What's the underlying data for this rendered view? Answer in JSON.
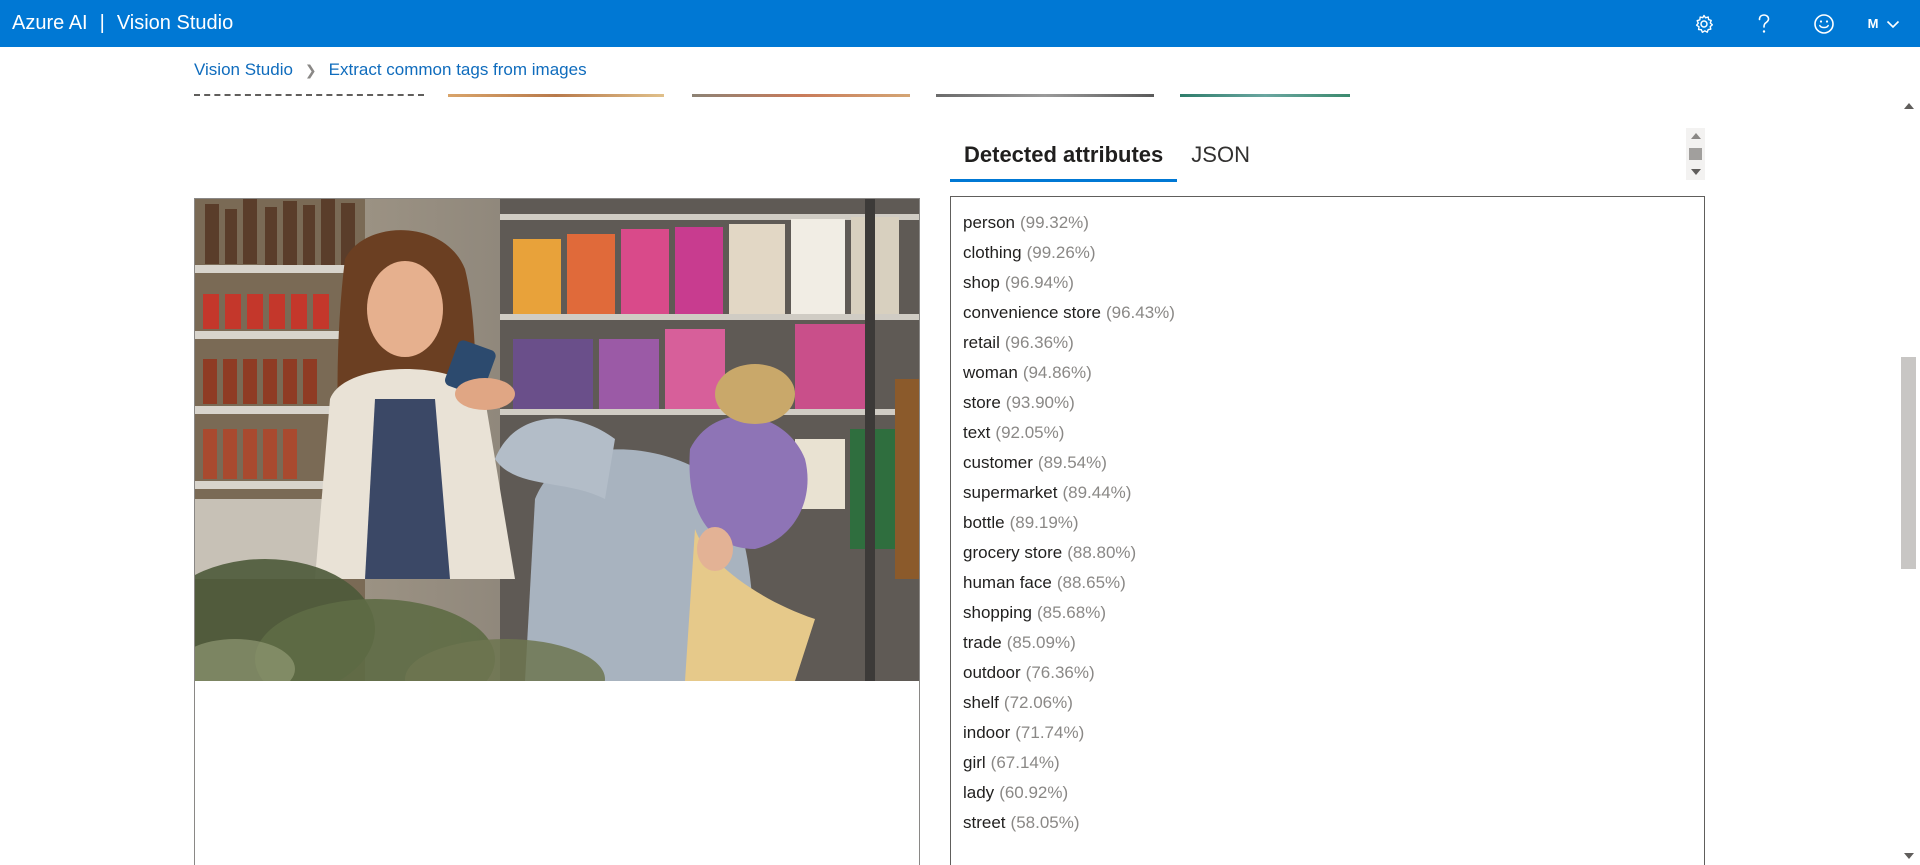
{
  "app": {
    "brand": "Azure AI",
    "separator": "|",
    "product": "Vision Studio",
    "accent_color": "#0078d4"
  },
  "header_icons": [
    "settings-icon",
    "help-icon",
    "feedback-smiley-icon",
    "chevron-down-icon"
  ],
  "account": {
    "initial": "M"
  },
  "breadcrumb": {
    "home": "Vision Studio",
    "current": "Extract common tags from images"
  },
  "tabs": [
    {
      "label": "Detected attributes",
      "active": true
    },
    {
      "label": "JSON",
      "active": false
    }
  ],
  "attributes": [
    {
      "name": "person",
      "confidence": "(99.32%)"
    },
    {
      "name": "clothing",
      "confidence": "(99.26%)"
    },
    {
      "name": "shop",
      "confidence": "(96.94%)"
    },
    {
      "name": "convenience store",
      "confidence": "(96.43%)"
    },
    {
      "name": "retail",
      "confidence": "(96.36%)"
    },
    {
      "name": "woman",
      "confidence": "(94.86%)"
    },
    {
      "name": "store",
      "confidence": "(93.90%)"
    },
    {
      "name": "text",
      "confidence": "(92.05%)"
    },
    {
      "name": "customer",
      "confidence": "(89.54%)"
    },
    {
      "name": "supermarket",
      "confidence": "(89.44%)"
    },
    {
      "name": "bottle",
      "confidence": "(89.19%)"
    },
    {
      "name": "grocery store",
      "confidence": "(88.80%)"
    },
    {
      "name": "human face",
      "confidence": "(88.65%)"
    },
    {
      "name": "shopping",
      "confidence": "(85.68%)"
    },
    {
      "name": "trade",
      "confidence": "(85.09%)"
    },
    {
      "name": "outdoor",
      "confidence": "(76.36%)"
    },
    {
      "name": "shelf",
      "confidence": "(72.06%)"
    },
    {
      "name": "indoor",
      "confidence": "(71.74%)"
    },
    {
      "name": "girl",
      "confidence": "(67.14%)"
    },
    {
      "name": "lady",
      "confidence": "(60.92%)"
    },
    {
      "name": "street",
      "confidence": "(58.05%)"
    }
  ]
}
